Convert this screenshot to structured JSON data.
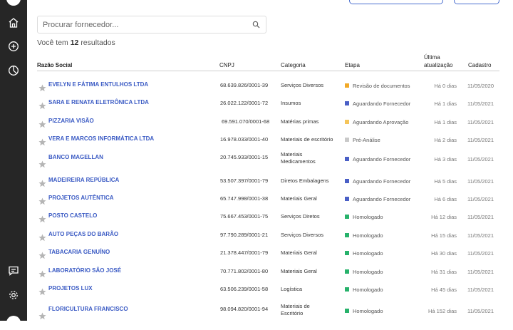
{
  "search": {
    "placeholder": "Procurar fornecedor..."
  },
  "results": {
    "prefix": "Você tem",
    "count": "12",
    "suffix": "resultados"
  },
  "sidebar": {
    "icons": [
      "home-icon",
      "plus-circle-icon",
      "pie-chart-icon",
      "chat-icon",
      "gear-icon"
    ]
  },
  "colors": {
    "sidebar_bg": "#262626",
    "link": "#3b5bc4",
    "yellow": "#f1a928",
    "light_yellow": "#f5c55a",
    "gray": "#c9c9c9",
    "blue": "#4a5fc6",
    "green": "#27b26b"
  },
  "table": {
    "headers": {
      "razao": "Razão Social",
      "cnpj": "CNPJ",
      "categoria": "Categoria",
      "etapa": "Etapa",
      "atualizacao_1": "Última",
      "atualizacao_2": "atualização",
      "cadastro": "Cadastro"
    },
    "rows": [
      {
        "name": "EVELYN E FÁTIMA ENTULHOS LTDA",
        "cnpj": "68.639.826/0001-39",
        "cat1": "Serviços Diversos",
        "cat2": "",
        "stage": "Revisão de documentos",
        "stage_color": "#f1a928",
        "updated": "Há 0 dias",
        "registered": "11/05/2020"
      },
      {
        "name": "SARA E RENATA ELETRÔNICA LTDA",
        "cnpj": "26.022.122/0001-72",
        "cat1": "Insumos",
        "cat2": "",
        "stage": "Aguardando Fornecedor",
        "stage_color": "#4a5fc6",
        "updated": "Há 1 dias",
        "registered": "11/05/2021"
      },
      {
        "name": "PIZZARIA VISÃO",
        "cnpj": "69.591.070/0001-68",
        "cat1": "Matérias primas",
        "cat2": "",
        "stage": "Aguardando Aprovação",
        "stage_color": "#f5c55a",
        "updated": "Há 1 dias",
        "registered": "11/05/2021"
      },
      {
        "name": "VERA E MARCOS INFORMÁTICA LTDA",
        "cnpj": "16.978.033/0001-40",
        "cat1": "Materiais de escritório",
        "cat2": "",
        "stage": "Pré-Análise",
        "stage_color": "#c9c9c9",
        "updated": "Há 2 dias",
        "registered": "11/05/2021"
      },
      {
        "name": "BANCO MAGELLAN",
        "cnpj": "20.745.933/0001-15",
        "cat1": "Materiais",
        "cat2": "Medicamentos",
        "stage": "Aguardando Fornecedor",
        "stage_color": "#4a5fc6",
        "updated": "Há 3 dias",
        "registered": "11/05/2021"
      },
      {
        "name": "MADEIREIRA REPÚBLICA",
        "cnpj": "53.507.397/0001-79",
        "cat1": "Diretos Embalagens",
        "cat2": "",
        "stage": "Aguardando Fornecedor",
        "stage_color": "#4a5fc6",
        "updated": "Há 5 dias",
        "registered": "11/05/2021"
      },
      {
        "name": "PROJETOS AUTÊNTICA",
        "cnpj": "65.747.998/0001-38",
        "cat1": "Materiais Geral",
        "cat2": "",
        "stage": "Aguardando Fornecedor",
        "stage_color": "#4a5fc6",
        "updated": "Há 6 dias",
        "registered": "11/05/2021"
      },
      {
        "name": "POSTO CASTELO",
        "cnpj": "75.667.453/0001-75",
        "cat1": "Serviços Diretos",
        "cat2": "",
        "stage": "Homologado",
        "stage_color": "#27b26b",
        "updated": "Há 12 dias",
        "registered": "11/05/2021"
      },
      {
        "name": "AUTO PEÇAS DO BARÃO",
        "cnpj": "97.790.289/0001-21",
        "cat1": "Serviços Diversos",
        "cat2": "",
        "stage": "Homologado",
        "stage_color": "#27b26b",
        "updated": "Há 15 dias",
        "registered": "11/05/2021"
      },
      {
        "name": "TABACARIA GENUÍNO",
        "cnpj": "21.378.447/0001-79",
        "cat1": "Materiais Geral",
        "cat2": "",
        "stage": "Homologado",
        "stage_color": "#27b26b",
        "updated": "Há 30 dias",
        "registered": "11/05/2021"
      },
      {
        "name": "LABORATÓRIO SÃO JOSÉ",
        "cnpj": "70.771.802/0001-80",
        "cat1": "Materiais Geral",
        "cat2": "",
        "stage": "Homologado",
        "stage_color": "#27b26b",
        "updated": "Há 31 dias",
        "registered": "11/05/2021"
      },
      {
        "name": "PROJETOS LUX",
        "cnpj": "63.506.239/0001-58",
        "cat1": "Logística",
        "cat2": "",
        "stage": "Homologado",
        "stage_color": "#27b26b",
        "updated": "Há 45 dias",
        "registered": "11/05/2021"
      },
      {
        "name": "FLORICULTURA FRANCISCO",
        "cnpj": "98.094.820/0001-94",
        "cat1": "Materiais de",
        "cat2": "Escritório",
        "stage": "Homologado",
        "stage_color": "#27b26b",
        "updated": "Há 152 dias",
        "registered": "11/05/2021"
      }
    ]
  }
}
